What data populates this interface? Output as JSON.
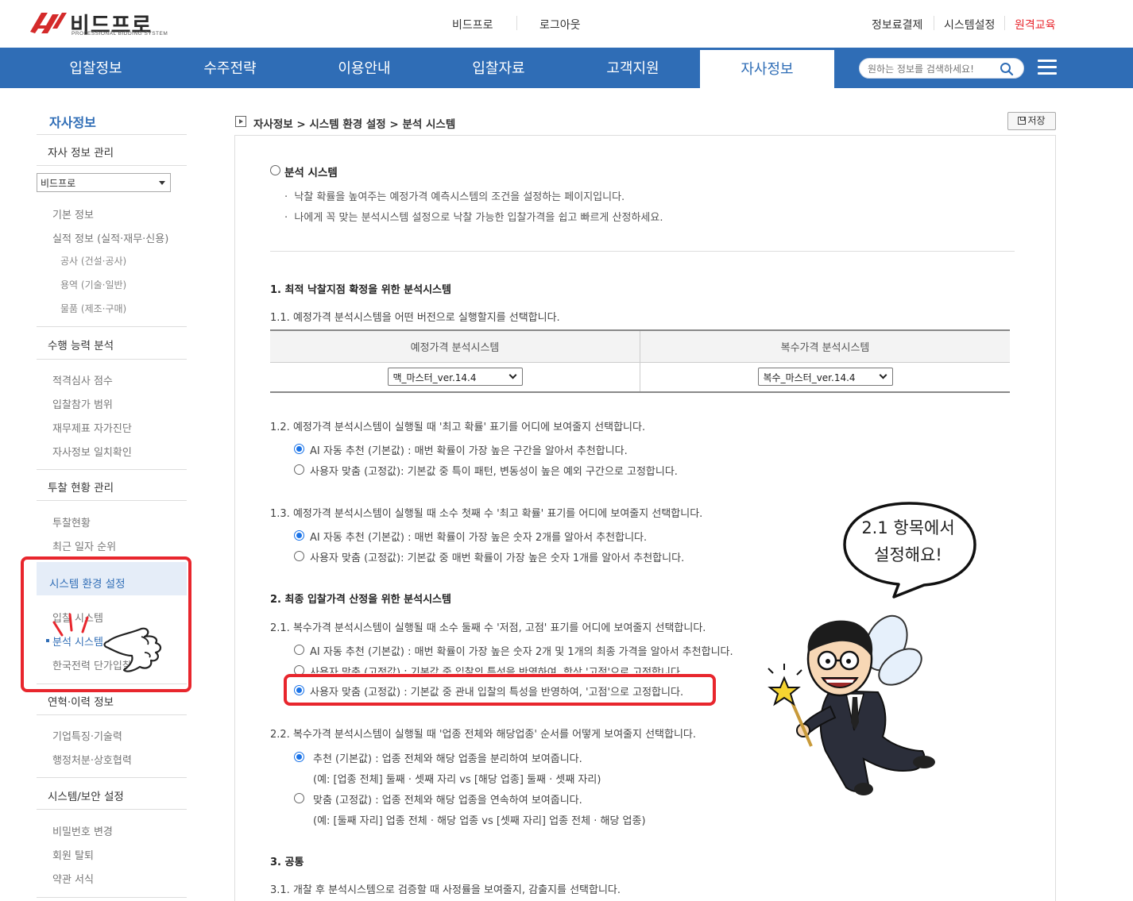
{
  "header": {
    "brand": "비드프로",
    "brand_sub": "PROFESSIONAL BIDDING SYSTEM",
    "center_links": [
      "비드프로",
      "로그아웃"
    ],
    "right_links": [
      "정보료결제",
      "시스템설정",
      "원격교육"
    ],
    "right_highlight_color": "#e8262d"
  },
  "nav": {
    "items": [
      "입찰정보",
      "수주전략",
      "이용안내",
      "입찰자료",
      "고객지원",
      "자사정보"
    ],
    "active": "자사정보",
    "search_placeholder": "원하는 정보를 검색하세요!",
    "bar_color": "#2f6db6"
  },
  "sidebar": {
    "title": "자사정보",
    "company_management": "자사 정보 관리",
    "company_select": "비드프로",
    "basic_info": "기본 정보",
    "performance": "실적 정보 (실적·재무·신용)",
    "perf_construction": "공사 (건설·공사)",
    "perf_service": "용역 (기술·일반)",
    "perf_goods": "물품 (제조·구매)",
    "capability": "수행 능력 분석",
    "cap_items": [
      "적격심사 점수",
      "입찰참가 범위",
      "재무제표 자가진단",
      "자사정보 일치확인"
    ],
    "bid_status": "투찰 현황 관리",
    "bid_items": [
      "투찰현황",
      "최근 일자 순위"
    ],
    "system_env": "시스템 환경 설정",
    "sys_items": [
      "입찰 시스템",
      "분석 시스템",
      "한국전력 단가입찰"
    ],
    "history": "연혁·이력 정보",
    "history_items": [
      "기업특징·기술력",
      "행정처분·상호협력"
    ],
    "security": "시스템/보안 설정",
    "security_items": [
      "비밀번호 변경",
      "회원 탈퇴",
      "약관 서식"
    ]
  },
  "content": {
    "breadcrumb": "자사정보 > 시스템 환경 설정 > 분석 시스템",
    "save_label": "저장",
    "section_title": "분석 시스템",
    "intro": [
      "낙찰 확률을 높여주는 예정가격 예측시스템의 조건을 설정하는 페이지입니다.",
      "나에게 꼭 맞는 분석시스템 설정으로 낙찰 가능한 입찰가격을 쉽고 빠르게 산정하세요."
    ],
    "s1_title": "1. 최적 낙찰지점 확정을 위한 분석시스템",
    "s1_1": "1.1. 예정가격 분석시스템을 어떤 버전으로 실행할지를 선택합니다.",
    "table_headers": [
      "예정가격 분석시스템",
      "복수가격 분석시스템"
    ],
    "table_values": [
      "맥_마스터_ver.14.4",
      "복수_마스터_ver.14.4"
    ],
    "s1_2": "1.2. 예정가격 분석시스템이 실행될 때 '최고 확률' 표기를 어디에 보여줄지 선택합니다.",
    "s1_2_opts": [
      "AI 자동 추천 (기본값) : 매번 확률이 가장 높은 구간을 알아서 추천합니다.",
      "사용자 맞춤 (고정값): 기본값 중 특이 패턴, 변동성이 높은 예외 구간으로 고정합니다."
    ],
    "s1_3": "1.3. 예정가격 분석시스템이 실행될 때 소수 첫째 수 '최고 확률' 표기를 어디에 보여줄지 선택합니다.",
    "s1_3_opts": [
      "AI 자동 추천 (기본값) : 매번 확률이 가장 높은 숫자 2개를 알아서 추천합니다.",
      "사용자 맞춤 (고정값): 기본값 중 매번 확률이 가장 높은 숫자 1개를 알아서 추천합니다."
    ],
    "s2_title": "2. 최종 입찰가격 산정을 위한 분석시스템",
    "s2_1": "2.1. 복수가격 분석시스템이 실행될 때 소수 둘째 수 '저점, 고점' 표기를 어디에 보여줄지 선택합니다.",
    "s2_1_opts": [
      "AI 자동 추천 (기본값) : 매번 확률이 가장 높은 숫자 2개 및 1개의 최종 가격을 알아서 추천합니다.",
      "사용자 맞춤 (고정값) : 기본값 중 입찰의 특성을 반영하여, 항상 '고점'으로 고정합니다.",
      "사용자 맞춤 (고정값) : 기본값 중 관내 입찰의 특성을 반영하여, '고점'으로 고정합니다."
    ],
    "s2_2": "2.2. 복수가격 분석시스템이 실행될 때 '업종 전체와 해당업종' 순서를 어떻게 보여줄지 선택합니다.",
    "s2_2_opts": [
      "추천 (기본값) : 업종 전체와 해당 업종을 분리하여 보여줍니다.",
      "맞춤 (고정값) : 업종 전체와 해당 업종을 연속하여 보여줍니다."
    ],
    "s2_2_notes": [
      "(예: [업종 전체] 둘째 · 셋째 자리 vs [해당 업종] 둘째 · 셋째 자리)",
      "(예: [둘째 자리] 업종 전체 · 해당 업종 vs [셋째 자리] 업종 전체 · 해당 업종)"
    ],
    "s3_title": "3. 공통",
    "s3_1": "3.1. 개찰 후 분석시스템으로 검증할 때 사정률을 보여줄지, 감출지를 선택합니다."
  },
  "annotation": {
    "bubble_lines": [
      "2.1 항목에서",
      "설정해요!"
    ],
    "highlight_color": "#e8262d"
  }
}
